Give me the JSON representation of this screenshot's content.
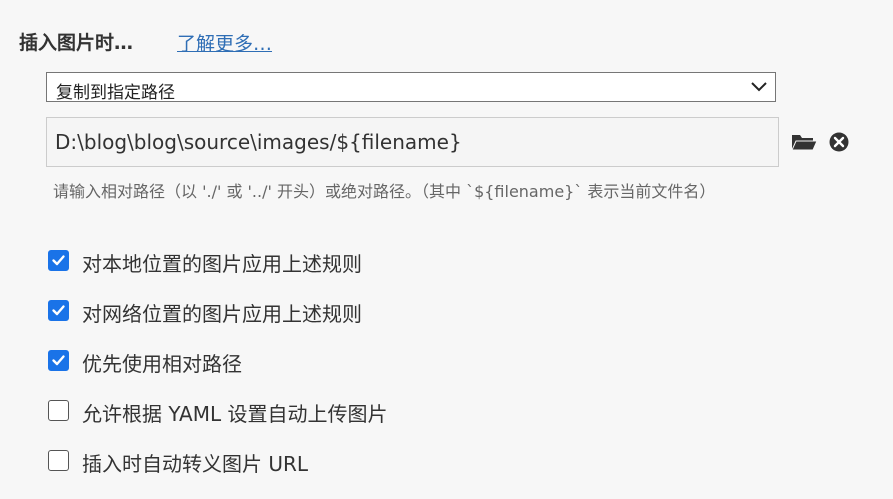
{
  "header": {
    "title": "插入图片时…",
    "learn_more": "了解更多…"
  },
  "action_select": {
    "selected": "复制到指定路径",
    "icon": "chevron-down-icon"
  },
  "path_field": {
    "value": "D:\\blog\\blog\\source\\images/${filename}",
    "browse_icon": "folder-open-icon",
    "clear_icon": "clear-circle-x-icon"
  },
  "hint": "请输入相对路径（以 './' 或 '../' 开头）或绝对路径。（其中 `${filename}` 表示当前文件名）",
  "options": [
    {
      "label": "对本地位置的图片应用上述规则",
      "checked": true
    },
    {
      "label": "对网络位置的图片应用上述规则",
      "checked": true
    },
    {
      "label": "优先使用相对路径",
      "checked": true
    },
    {
      "label": "允许根据 YAML 设置自动上传图片",
      "checked": false
    },
    {
      "label": "插入时自动转义图片 URL",
      "checked": false
    }
  ],
  "colors": {
    "accent": "#1a73e8",
    "link": "#2f6eb5",
    "text": "#333333",
    "muted": "#666666",
    "background": "#f7f7f7"
  }
}
